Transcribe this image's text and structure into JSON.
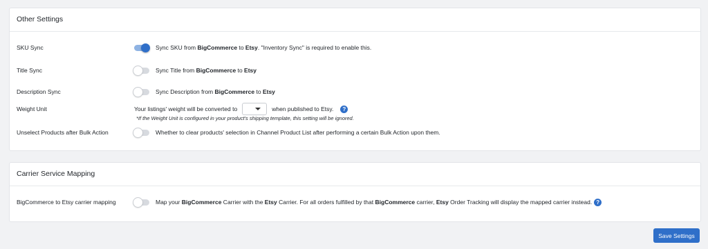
{
  "other_settings": {
    "title": "Other Settings",
    "sku_sync": {
      "label": "SKU Sync",
      "enabled": true,
      "desc_pre": "Sync SKU from ",
      "source": "BigCommerce",
      "mid": " to ",
      "target": "Etsy",
      "desc_post": ". \"Inventory Sync\" is required to enable this."
    },
    "title_sync": {
      "label": "Title Sync",
      "enabled": false,
      "desc_pre": "Sync Title from ",
      "source": "BigCommerce",
      "mid": " to ",
      "target": "Etsy"
    },
    "description_sync": {
      "label": "Description Sync",
      "enabled": false,
      "desc_pre": "Sync Description from ",
      "source": "BigCommerce",
      "mid": " to ",
      "target": "Etsy"
    },
    "weight_unit": {
      "label": "Weight Unit",
      "text_before": "Your listings' weight will be converted to",
      "selected_value": "",
      "text_after": "when published to Etsy.",
      "help": "?",
      "note": "*If the Weight Unit is configured in your product's shipping template, this setting will be ignored."
    },
    "unselect_products": {
      "label": "Unselect Products after Bulk Action",
      "enabled": false,
      "desc": "Whether to clear products' selection in Channel Product List after performing a certain Bulk Action upon them."
    }
  },
  "carrier_mapping": {
    "title": "Carrier Service Mapping",
    "row": {
      "label": "BigCommerce to Etsy carrier mapping",
      "enabled": false,
      "t1": "Map your ",
      "b1": "BigCommerce",
      "t2": " Carrier with the ",
      "b2": "Etsy",
      "t3": " Carrier. For all orders fulfilled by that ",
      "b3": "BigCommerce",
      "t4": " carrier, ",
      "b4": "Etsy",
      "t5": " Order Tracking will display the mapped carrier instead.",
      "help": "?"
    }
  },
  "actions": {
    "save_label": "Save Settings"
  },
  "colors": {
    "accent": "#2f6fc9",
    "page_bg": "#f1f2f4"
  }
}
